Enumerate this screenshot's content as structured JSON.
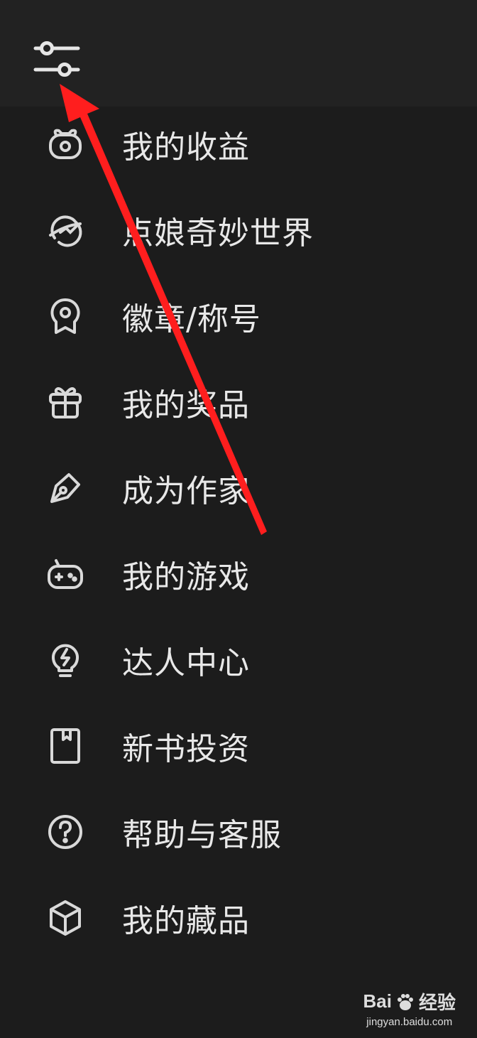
{
  "header": {
    "settings_icon": "sliders-icon"
  },
  "menu": {
    "items": [
      {
        "label": "我的收益",
        "icon": "piggy-bank-icon"
      },
      {
        "label": "点娘奇妙世界",
        "icon": "planet-icon"
      },
      {
        "label": "徽章/称号",
        "icon": "medal-icon"
      },
      {
        "label": "我的奖品",
        "icon": "gift-icon"
      },
      {
        "label": "成为作家",
        "icon": "pen-icon"
      },
      {
        "label": "我的游戏",
        "icon": "gamepad-icon"
      },
      {
        "label": "达人中心",
        "icon": "lightbulb-icon"
      },
      {
        "label": "新书投资",
        "icon": "bookmark-book-icon"
      },
      {
        "label": "帮助与客服",
        "icon": "help-circle-icon"
      },
      {
        "label": "我的藏品",
        "icon": "cube-icon"
      }
    ]
  },
  "watermark": {
    "brand": "Bai",
    "brand_suffix": "经验",
    "url": "jingyan.baidu.com"
  },
  "colors": {
    "background": "#1c1c1c",
    "topbar": "#222222",
    "icon": "#d9d9d9",
    "annotation_arrow": "#ff1e1e"
  }
}
